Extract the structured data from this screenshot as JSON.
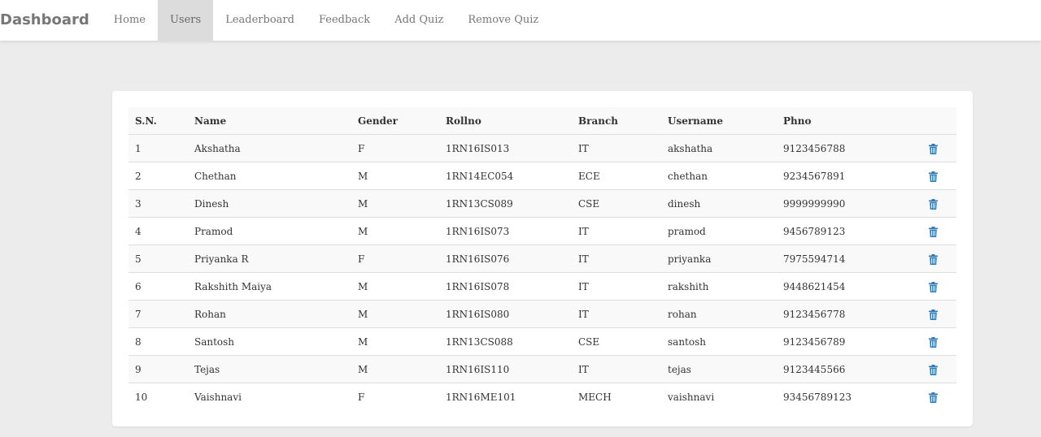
{
  "navbar": {
    "brand": "Dashboard",
    "items": [
      {
        "label": "Home",
        "active": false
      },
      {
        "label": "Users",
        "active": true
      },
      {
        "label": "Leaderboard",
        "active": false
      },
      {
        "label": "Feedback",
        "active": false
      },
      {
        "label": "Add Quiz",
        "active": false
      },
      {
        "label": "Remove Quiz",
        "active": false
      }
    ]
  },
  "table": {
    "headers": [
      "S.N.",
      "Name",
      "Gender",
      "Rollno",
      "Branch",
      "Username",
      "Phno",
      ""
    ],
    "rows": [
      [
        "1",
        "Akshatha",
        "F",
        "1RN16IS013",
        "IT",
        "akshatha",
        "9123456788"
      ],
      [
        "2",
        "Chethan",
        "M",
        "1RN14EC054",
        "ECE",
        "chethan",
        "9234567891"
      ],
      [
        "3",
        "Dinesh",
        "M",
        "1RN13CS089",
        "CSE",
        "dinesh",
        "9999999990"
      ],
      [
        "4",
        "Pramod",
        "M",
        "1RN16IS073",
        "IT",
        "pramod",
        "9456789123"
      ],
      [
        "5",
        "Priyanka R",
        "F",
        "1RN16IS076",
        "IT",
        "priyanka",
        "7975594714"
      ],
      [
        "6",
        "Rakshith Maiya",
        "M",
        "1RN16IS078",
        "IT",
        "rakshith",
        "9448621454"
      ],
      [
        "7",
        "Rohan",
        "M",
        "1RN16IS080",
        "IT",
        "rohan",
        "9123456778"
      ],
      [
        "8",
        "Santosh",
        "M",
        "1RN13CS088",
        "CSE",
        "santosh",
        "9123456789"
      ],
      [
        "9",
        "Tejas",
        "M",
        "1RN16IS110",
        "IT",
        "tejas",
        "9123445566"
      ],
      [
        "10",
        "Vaishnavi",
        "F",
        "1RN16ME101",
        "MECH",
        "vaishnavi",
        "93456789123"
      ]
    ],
    "action_icon": "trash-icon",
    "icon_color": "#337ab7"
  }
}
